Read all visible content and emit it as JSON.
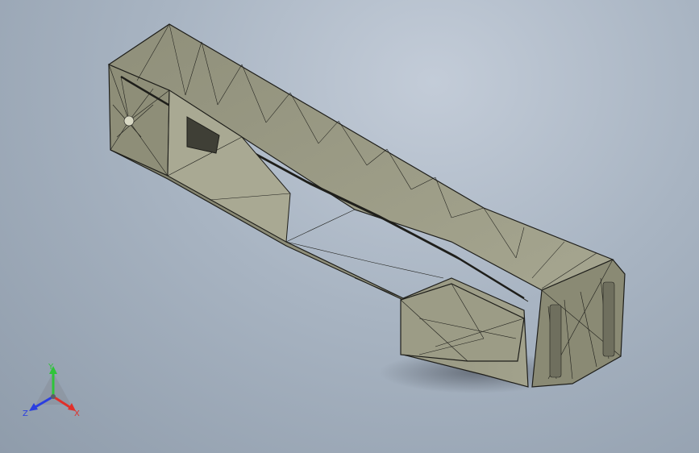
{
  "viewport": {
    "background_top": "#c3ccd8",
    "background_bottom": "#8f9cab",
    "model_color": "#9a9a86",
    "edge_color": "#1e1e1a"
  },
  "triad": {
    "x_label": "X",
    "y_label": "Y",
    "z_label": "Z",
    "x_color": "#e0302a",
    "y_color": "#2fc43a",
    "z_color": "#2a3ee0"
  }
}
